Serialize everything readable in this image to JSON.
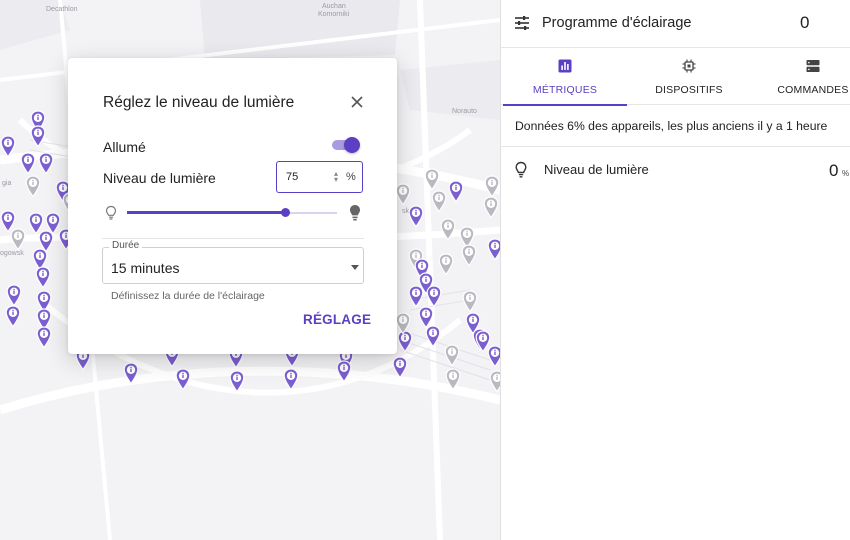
{
  "map": {
    "labels": [
      "Decathlon",
      "Auchan",
      "Komorniki",
      "Norauto",
      "gia",
      "ska",
      "ogowsk"
    ]
  },
  "dialog": {
    "title": "Réglez le niveau de lumière",
    "on_label": "Allumé",
    "on_state": true,
    "level_label": "Niveau de lumière",
    "level_value": "75",
    "level_fraction": 0.75,
    "unit": "%",
    "duration_legend": "Durée",
    "duration_value": "15 minutes",
    "duration_helper": "Définissez la durée de l'éclairage",
    "apply_label": "RÉGLAGE"
  },
  "panel": {
    "title": "Programme d'éclairage",
    "count": "0",
    "tabs": [
      {
        "label": "MÉTRIQUES",
        "icon": "bar-chart-icon",
        "active": true
      },
      {
        "label": "DISPOSITIFS",
        "icon": "chip-icon",
        "active": false
      },
      {
        "label": "COMMANDES",
        "icon": "server-icon",
        "active": false
      }
    ],
    "info": "Données 6% des appareils, les plus anciens il y a 1 heure",
    "metric": {
      "label": "Niveau de lumière",
      "value": "0",
      "unit": "%"
    }
  },
  "colors": {
    "accent": "#5b3fc4",
    "pin_active": "#7b5fd0",
    "pin_inactive": "#b9b9c2"
  }
}
